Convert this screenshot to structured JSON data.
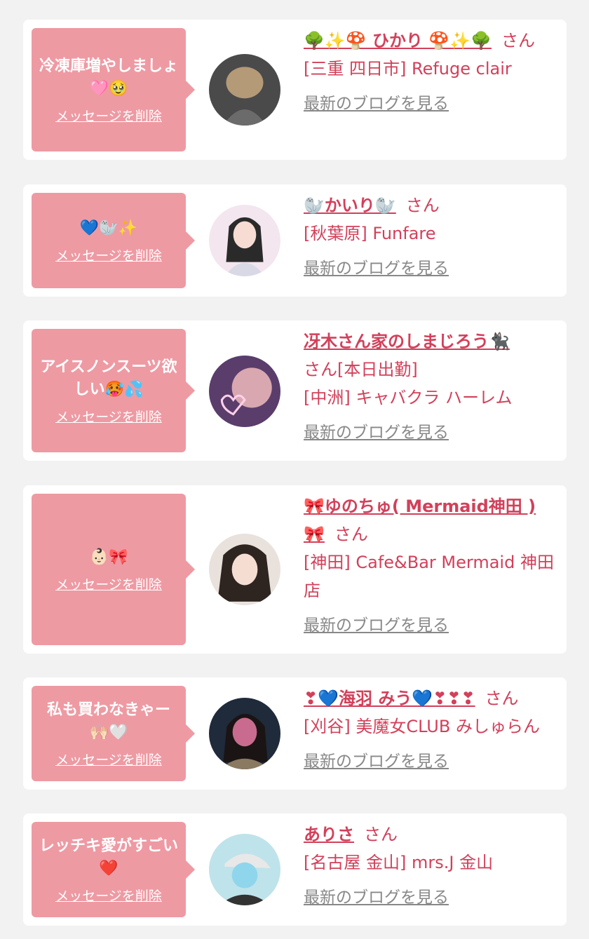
{
  "suffix": "さん",
  "delete_label": "メッセージを削除",
  "blog_label": "最新のブログを見る",
  "items": [
    {
      "message": "冷凍庫増やしましょ🩷🥹",
      "name": "🌳✨🍄 ひかり 🍄✨🌳",
      "tag": "",
      "shop": "[三重 四日市] Refuge clair",
      "avatar": "avatar-hair-back-icon",
      "avatar_colors": [
        "#4a4a4a",
        "#b59a78"
      ]
    },
    {
      "message": "💙🦭✨",
      "name": "🦭かいり🦭",
      "tag": "",
      "shop": "[秋葉原] Funfare",
      "avatar": "avatar-girl-icon",
      "avatar_colors": [
        "#f3e6ef",
        "#2a2a2a"
      ]
    },
    {
      "message": "アイスノンスーツ欲しい🥵💦",
      "name": "冴木さん家のしまじろう🐈‍⬛",
      "tag": "[本日出勤]",
      "shop": "[中洲] キャバクラ ハーレム",
      "avatar": "avatar-glow-icon",
      "avatar_colors": [
        "#5a3d6b",
        "#d8a7b0"
      ]
    },
    {
      "message": "👶🏻🎀",
      "name": "🎀ゆのちゅ( Mermaid神田 )🎀",
      "tag": "",
      "shop": "[神田] Cafe&Bar Mermaid 神田店",
      "avatar": "avatar-twintail-icon",
      "avatar_colors": [
        "#e9e2dc",
        "#2e2420"
      ]
    },
    {
      "message": "私も買わなきゃー🙌🏻🤍",
      "name": "❣💙海羽 みう💙❣❣❣",
      "tag": "",
      "shop": "[刈谷] 美魔女CLUB みしゅらん",
      "avatar": "avatar-night-icon",
      "avatar_colors": [
        "#1f2a3a",
        "#c86b8f"
      ]
    },
    {
      "message": "レッチキ愛がすごい❤️",
      "name": "ありさ",
      "tag": "",
      "shop": "[名古屋 金山] mrs.J 金山",
      "avatar": "avatar-cap-icon",
      "avatar_colors": [
        "#bfe3ea",
        "#333333"
      ]
    }
  ]
}
